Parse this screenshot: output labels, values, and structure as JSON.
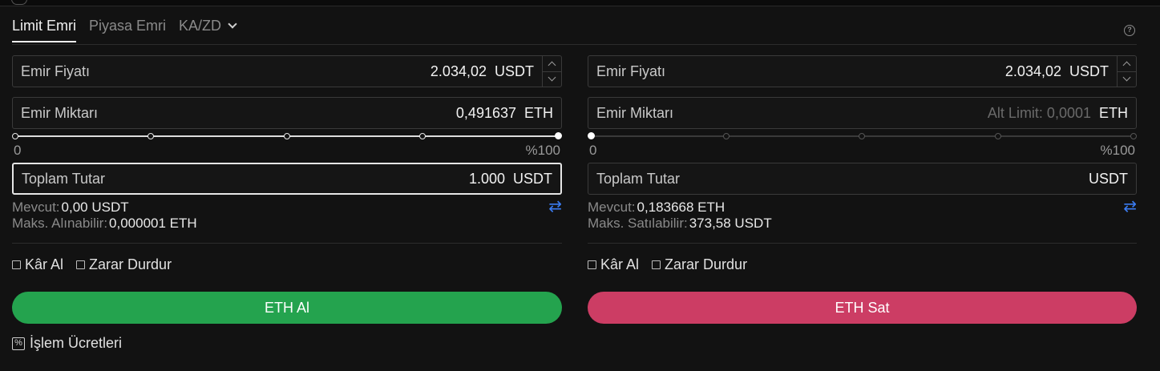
{
  "tabs": [
    {
      "label": "Limit Emri",
      "active": true
    },
    {
      "label": "Piyasa Emri",
      "active": false
    },
    {
      "label": "KA/ZD",
      "active": false,
      "dropdown": true
    }
  ],
  "help_icon": "?",
  "buy": {
    "price": {
      "label": "Emir Fiyatı",
      "value": "2.034,02",
      "unit": "USDT"
    },
    "amount": {
      "label": "Emir Miktarı",
      "value": "0,491637",
      "unit": "ETH"
    },
    "slider": {
      "min_label": "0",
      "max_label": "%100",
      "level": 1.0
    },
    "total": {
      "label": "Toplam Tutar",
      "value": "1.000",
      "unit": "USDT"
    },
    "available": {
      "label": "Mevcut:",
      "value": "0,00 USDT"
    },
    "max": {
      "label": "Maks. Alınabilir:",
      "value": "0,000001 ETH"
    },
    "take_profit": "Kâr Al",
    "stop_loss": "Zarar Durdur",
    "button": "ETH Al",
    "button_color": "#24a34e"
  },
  "sell": {
    "price": {
      "label": "Emir Fiyatı",
      "value": "2.034,02",
      "unit": "USDT"
    },
    "amount": {
      "label": "Emir Miktarı",
      "placeholder": "Alt Limit: 0,0001",
      "unit": "ETH"
    },
    "slider": {
      "min_label": "0",
      "max_label": "%100",
      "level": 0.0
    },
    "total": {
      "label": "Toplam Tutar",
      "value": "",
      "unit": "USDT"
    },
    "available": {
      "label": "Mevcut:",
      "value": "0,183668 ETH"
    },
    "max": {
      "label": "Maks. Satılabilir:",
      "value": "373,58 USDT"
    },
    "take_profit": "Kâr Al",
    "stop_loss": "Zarar Durdur",
    "button": "ETH Sat",
    "button_color": "#cc3d64"
  },
  "fees": {
    "label": "İşlem Ücretleri",
    "icon": "percent-icon"
  }
}
